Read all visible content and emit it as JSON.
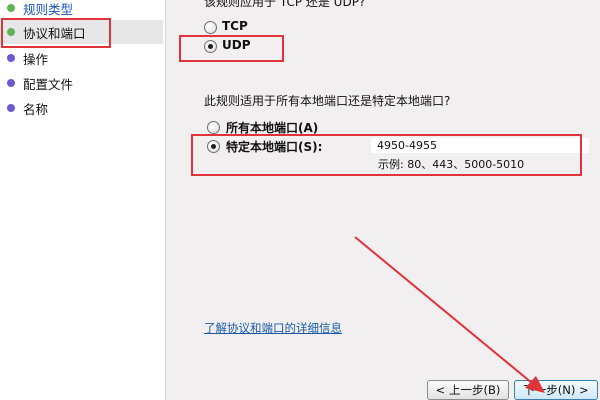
{
  "sidebar": {
    "items": [
      {
        "label": "规则类型"
      },
      {
        "label": "协议和端口"
      },
      {
        "label": "操作"
      },
      {
        "label": "配置文件"
      },
      {
        "label": "名称"
      }
    ]
  },
  "main": {
    "protocol_question": "该规则应用于 TCP 还是 UDP?",
    "protocol_options": [
      {
        "label": "TCP",
        "checked": false
      },
      {
        "label": "UDP",
        "checked": true
      }
    ],
    "port_question": "此规则适用于所有本地端口还是特定本地端口?",
    "port_options": [
      {
        "label": "所有本地端口(A)",
        "checked": false
      },
      {
        "label": "特定本地端口(S):",
        "checked": true
      }
    ],
    "port_value": "4950-4955",
    "port_example": "示例: 80、443、5000-5010",
    "info_link": "了解协议和端口的详细信息"
  },
  "footer": {
    "back_label": "< 上一步(B)",
    "next_label": "下一步(N) >"
  },
  "colors": {
    "annotation_red": "#e0343a",
    "link_blue": "#1a5aa8"
  }
}
